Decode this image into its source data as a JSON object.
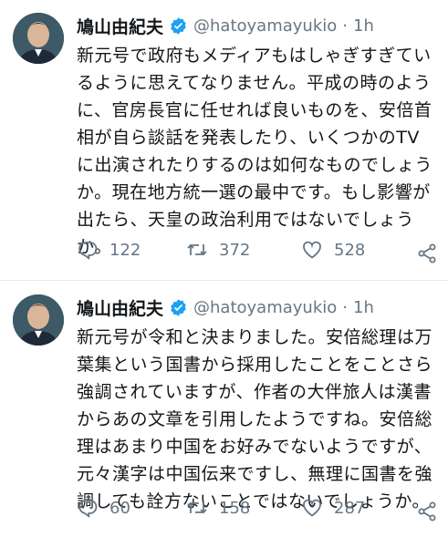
{
  "tweets": [
    {
      "author_name": "鳩山由紀夫",
      "handle": "@hatoyamayukio",
      "separator": "·",
      "time": "1h",
      "lines": [
        "新元号で政府もメディアもはしゃぎすぎてい",
        "るように思えてなりません。平成の時のよう",
        "に、官房長官に任せれば良いものを、安倍首",
        "相が自ら談話を発表したり、いくつかのTV",
        "に出演されたりするのは如何なものでしょう",
        "か。現在地方統一選の最中です。もし影響が",
        "出たら、天皇の政治利用ではないでしょう",
        "か。"
      ],
      "replies": "122",
      "retweets": "372",
      "likes": "528"
    },
    {
      "author_name": "鳩山由紀夫",
      "handle": "@hatoyamayukio",
      "separator": "·",
      "time": "1h",
      "lines": [
        "新元号が令和と決まりました。安倍総理は万",
        "葉集という国書から採用したことをことさら",
        "強調されていますが、作者の大伴旅人は漢書",
        "からあの文章を引用したようですね。安倍総",
        "理はあまり中国をお好みでないようですが、",
        "元々漢字は中国伝来ですし、無理に国書を強",
        "調しても詮方ないことではないでしょうか。"
      ],
      "replies": "60",
      "retweets": "158",
      "likes": "287"
    }
  ],
  "icons": {
    "verified": "verified-badge-icon",
    "reply": "reply-icon",
    "retweet": "retweet-icon",
    "like": "heart-icon",
    "share": "share-icon"
  },
  "colors": {
    "verified": "#1da1f2",
    "muted": "#657786",
    "text": "#14171a",
    "divider": "#e1e8ed"
  }
}
